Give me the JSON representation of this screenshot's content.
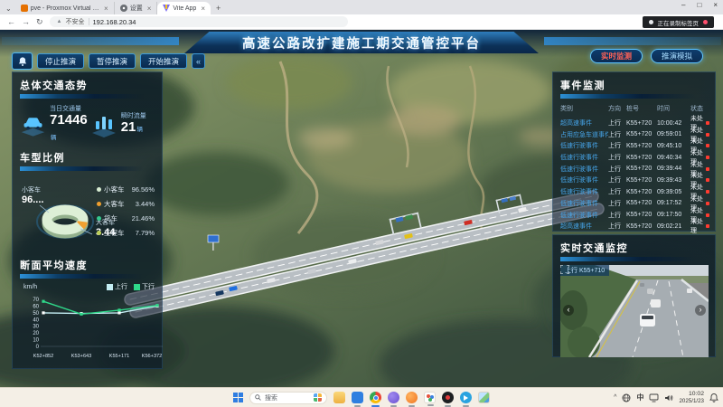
{
  "browser": {
    "tabs": [
      {
        "title": "pve - Proxmox Virtual Envi...",
        "icon": "proxmox-favicon"
      },
      {
        "title": "设置",
        "icon": "settings-favicon"
      },
      {
        "title": "Vite App",
        "icon": "vite-favicon"
      }
    ],
    "new_tab_label": "+",
    "security_label": "不安全",
    "url": "192.168.20.34",
    "recording_badge": "正在录制标签页",
    "window_controls": {
      "minimize": "–",
      "maximize": "□",
      "close": "×"
    }
  },
  "icons": {
    "back": "←",
    "forward": "→",
    "reload": "↻",
    "warning": "▲",
    "collapse": "«",
    "tab_chevron": "⌄",
    "prev": "‹",
    "next": "›",
    "tray_chevron": "^",
    "ime": "中",
    "close_tab": "×"
  },
  "dashboard": {
    "title": "高速公路改扩建施工期交通管控平台",
    "sim_buttons": [
      "停止推演",
      "暂停推演",
      "开始推演"
    ],
    "mode_buttons": [
      "实时监测",
      "推演模拟"
    ],
    "traffic_overview": {
      "title": "总体交通态势",
      "stats": [
        {
          "label": "当日交通量",
          "value": "71446",
          "unit": "辆"
        },
        {
          "label": "瞬时流量",
          "value": "21",
          "unit": "辆"
        }
      ]
    },
    "vehicle_ratio": {
      "title": "车型比例",
      "callout_left": {
        "label": "小客车",
        "value": "96...."
      },
      "callout_right": {
        "label": "大客车",
        "value": "3.44"
      },
      "legend": [
        {
          "label": "小客车",
          "value": "96.56%",
          "color": "#d9eed4"
        },
        {
          "label": "大客车",
          "value": "3.44%",
          "color": "#f09f2e"
        },
        {
          "label": "货车",
          "value": "21.46%",
          "color": "#35c98e"
        },
        {
          "label": "工程车",
          "value": "7.79%",
          "color": "#bccf55"
        }
      ]
    },
    "avg_speed": {
      "title": "断面平均速度",
      "unit": "km/h"
    },
    "events": {
      "title": "事件监测",
      "columns": [
        "类别",
        "方向",
        "桩号",
        "时间",
        "状态"
      ],
      "rows": [
        {
          "category": "超高速事件",
          "direction": "上行",
          "stake": "K55+720",
          "time": "10:00:42",
          "status": "未处理"
        },
        {
          "category": "占用应急车道事件",
          "direction": "上行",
          "stake": "K55+720",
          "time": "09:59:01",
          "status": "未处理"
        },
        {
          "category": "低速行驶事件",
          "direction": "上行",
          "stake": "K55+720",
          "time": "09:45:10",
          "status": "未处理"
        },
        {
          "category": "低速行驶事件",
          "direction": "上行",
          "stake": "K55+720",
          "time": "09:40:34",
          "status": "未处理"
        },
        {
          "category": "低速行驶事件",
          "direction": "上行",
          "stake": "K55+720",
          "time": "09:39:44",
          "status": "未处理"
        },
        {
          "category": "低速行驶事件",
          "direction": "上行",
          "stake": "K55+720",
          "time": "09:39:43",
          "status": "未处理"
        },
        {
          "category": "低速行驶事件",
          "direction": "上行",
          "stake": "K55+720",
          "time": "09:39:05",
          "status": "未处理"
        },
        {
          "category": "低速行驶事件",
          "direction": "上行",
          "stake": "K55+720",
          "time": "09:17:52",
          "status": "未处理"
        },
        {
          "category": "低速行驶事件",
          "direction": "上行",
          "stake": "K55+720",
          "time": "09:17:50",
          "status": "未处理"
        },
        {
          "category": "超高速事件",
          "direction": "上行",
          "stake": "K55+720",
          "time": "09:02:21",
          "status": "未处理"
        }
      ]
    },
    "camera": {
      "title": "实时交通监控",
      "label": "上行 K55+710"
    }
  },
  "chart_data": [
    {
      "type": "pie",
      "title": "车型比例",
      "labels": [
        "小客车",
        "大客车",
        "货车",
        "工程车"
      ],
      "values": [
        96.56,
        3.44,
        21.46,
        7.79
      ],
      "unit": "%",
      "colors": [
        "#d9eed4",
        "#f09f2e",
        "#35c98e",
        "#bccf55"
      ]
    },
    {
      "type": "line",
      "title": "断面平均速度",
      "ylabel": "km/h",
      "ylim": [
        0,
        70
      ],
      "yticks": [
        0,
        10,
        20,
        30,
        40,
        50,
        60,
        70
      ],
      "categories": [
        "K52+852",
        "K53+643",
        "K55+171",
        "K56+372"
      ],
      "series": [
        {
          "name": "上行",
          "color": "#c4eef4",
          "marker": "#ffffff",
          "values": [
            50,
            49,
            50,
            60
          ]
        },
        {
          "name": "下行",
          "color": "#2fd98a",
          "marker": "#2fd98a",
          "values": [
            67,
            48,
            54,
            61
          ]
        }
      ],
      "legend_position": "top-right",
      "grid": false
    }
  ],
  "taskbar": {
    "search_label": "搜索",
    "time": "10:02",
    "date": "2025/1/23"
  }
}
